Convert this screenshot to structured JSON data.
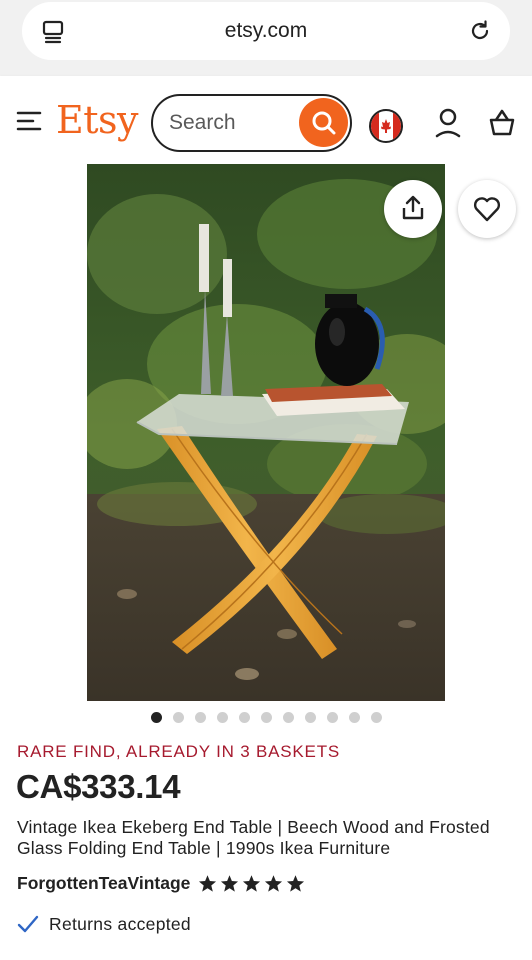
{
  "browser": {
    "url": "etsy.com",
    "tabs_icon": "tabs-icon",
    "reload_icon": "reload-icon"
  },
  "header": {
    "logo": "Etsy",
    "search_placeholder": "Search",
    "icons": [
      "menu-icon",
      "search-icon",
      "canada-flag-icon",
      "user-icon",
      "cart-icon"
    ]
  },
  "gallery": {
    "image_count": 11,
    "active_index": 0,
    "icons": [
      "share-icon",
      "heart-icon"
    ]
  },
  "listing": {
    "urgency": "RARE FIND, ALREADY IN 3 BASKETS",
    "price": "CA$333.14",
    "title": "Vintage Ikea Ekeberg End Table | Beech Wood and Frosted Glass Folding End Table | 1990s Ikea Furniture",
    "shop_name": "ForgottenTeaVintage",
    "rating_stars": 5,
    "returns": "Returns accepted"
  },
  "colors": {
    "brand_orange": "#f1641e",
    "urgency_red": "#a61a2e",
    "check_blue": "#2f66c5"
  }
}
